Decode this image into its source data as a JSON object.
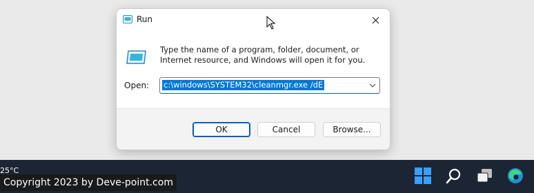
{
  "dialog": {
    "title": "Run",
    "description": "Type the name of a program, folder, document, or Internet resource, and Windows will open it for you.",
    "open_label": "Open:",
    "open_value": "c:\\windows\\SYSTEM32\\cleanmgr.exe /dE",
    "buttons": {
      "ok": "OK",
      "cancel": "Cancel",
      "browse": "Browse..."
    }
  },
  "taskbar": {
    "weather": "25°C",
    "icons": [
      "windows-start-icon",
      "search-icon",
      "task-view-icon",
      "edge-browser-icon"
    ]
  },
  "watermark": "Copyright 2023 by Deve-point.com",
  "colors": {
    "accent": "#0078d7",
    "taskbar": "#1c2533"
  }
}
